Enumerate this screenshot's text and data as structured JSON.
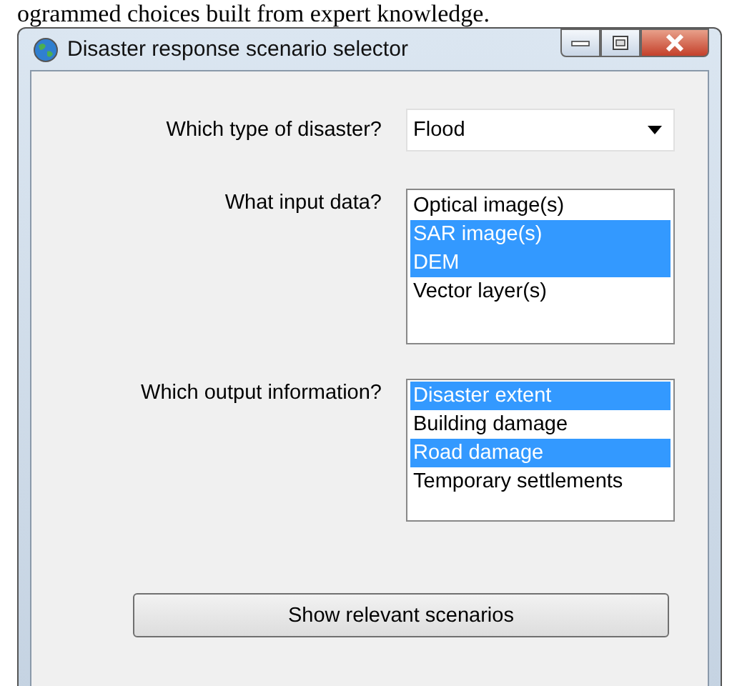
{
  "document_text": "ogrammed choices built from expert knowledge.",
  "window": {
    "title": "Disaster response scenario selector"
  },
  "disaster_type": {
    "label": "Which type of disaster?",
    "value": "Flood"
  },
  "input_data": {
    "label": "What input data?",
    "items": [
      {
        "label": "Optical image(s)",
        "selected": false
      },
      {
        "label": "SAR image(s)",
        "selected": true
      },
      {
        "label": "DEM",
        "selected": true
      },
      {
        "label": "Vector layer(s)",
        "selected": false
      }
    ]
  },
  "output_information": {
    "label": "Which output information?",
    "items": [
      {
        "label": "Disaster extent",
        "selected": true
      },
      {
        "label": "Building damage",
        "selected": false
      },
      {
        "label": "Road damage",
        "selected": true
      },
      {
        "label": "Temporary settlements",
        "selected": false
      }
    ]
  },
  "buttons": [
    "Show relevant scenarios"
  ]
}
